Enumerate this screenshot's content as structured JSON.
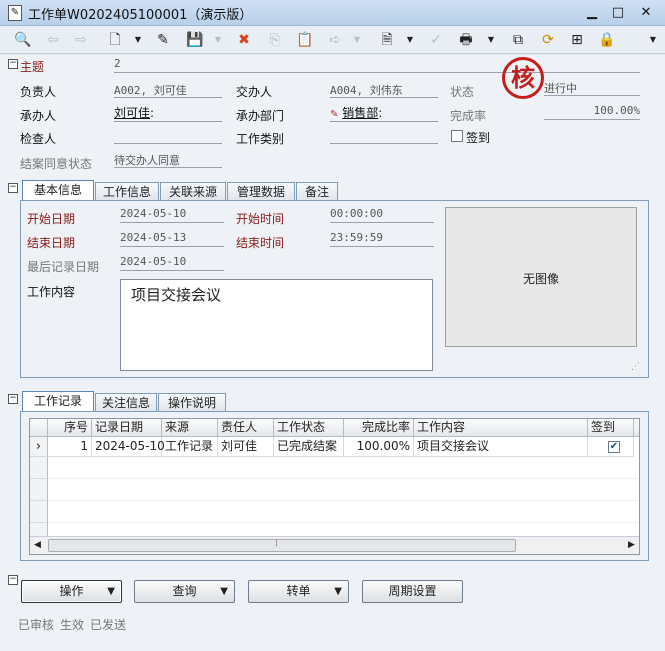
{
  "window": {
    "title": "工作单W0202405100001（演示版）",
    "minimize": "▁",
    "maximize": "□",
    "close": "✕"
  },
  "header": {
    "subject_label": "主题",
    "subject_value": "2",
    "owner_label": "负责人",
    "owner_value": "A002, 刘可佳",
    "handover_label": "交办人",
    "handover_value": "A004, 刘伟东",
    "status_label": "状态",
    "status_value": "进行中",
    "assignee_label": "承办人",
    "assignee_value": "刘可佳",
    "assignee_suffix": ":",
    "dept_label": "承办部门",
    "dept_value": "销售部",
    "dept_suffix": ":",
    "completion_label": "完成率",
    "completion_value": "100.00%",
    "checker_label": "检查人",
    "worktype_label": "工作类别",
    "signin_label": "签到",
    "agree_label": "结案同意状态",
    "agree_value": "待交办人同意",
    "stamp_text": "核"
  },
  "tabs1": [
    "基本信息",
    "工作信息",
    "关联来源",
    "管理数据",
    "备注"
  ],
  "basic": {
    "start_date_label": "开始日期",
    "start_date": "2024-05-10",
    "start_time_label": "开始时间",
    "start_time": "00:00:00",
    "end_date_label": "结束日期",
    "end_date": "2024-05-13",
    "end_time_label": "结束时间",
    "end_time": "23:59:59",
    "last_record_label": "最后记录日期",
    "last_record": "2024-05-10",
    "content_label": "工作内容",
    "content_value": "项目交接会议",
    "no_image": "无图像"
  },
  "tabs2": [
    "工作记录",
    "关注信息",
    "操作说明"
  ],
  "grid": {
    "columns": [
      "序号",
      "记录日期",
      "来源",
      "责任人",
      "工作状态",
      "完成比率",
      "工作内容",
      "签到"
    ],
    "rows": [
      [
        "1",
        "2024-05-10",
        "工作记录",
        "刘可佳",
        "已完成结案",
        "100.00%",
        "项目交接会议",
        "✔"
      ]
    ],
    "row_indicator": "›",
    "scroll_grip": "⁞"
  },
  "buttons": {
    "operate": "操作",
    "query": "查询",
    "transfer": "转单",
    "cycle": "周期设置",
    "dropdown_arrow": "▼"
  },
  "status_bar": [
    "已审核",
    "生效",
    "已发送"
  ],
  "collapse_glyph": "−"
}
